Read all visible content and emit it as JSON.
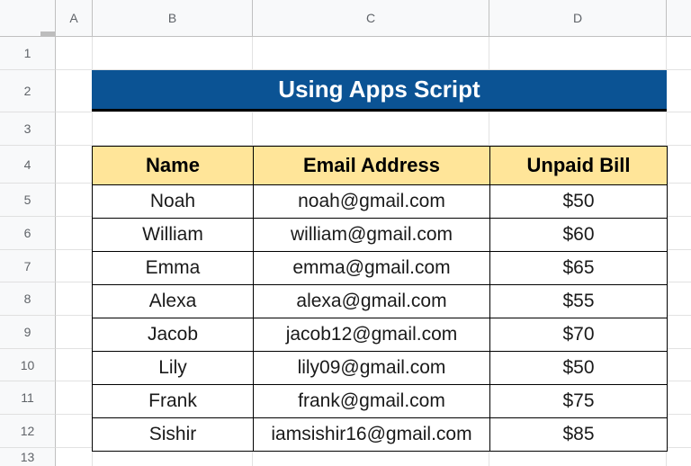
{
  "columns": [
    "A",
    "B",
    "C",
    "D"
  ],
  "rows": [
    "1",
    "2",
    "3",
    "4",
    "5",
    "6",
    "7",
    "8",
    "9",
    "10",
    "11",
    "12",
    "13"
  ],
  "title": "Using Apps Script",
  "table": {
    "headers": [
      "Name",
      "Email Address",
      "Unpaid Bill"
    ],
    "rows": [
      {
        "name": "Noah",
        "email": "noah@gmail.com",
        "bill": "$50"
      },
      {
        "name": "William",
        "email": "william@gmail.com",
        "bill": "$60"
      },
      {
        "name": "Emma",
        "email": "emma@gmail.com",
        "bill": "$65"
      },
      {
        "name": "Alexa",
        "email": "alexa@gmail.com",
        "bill": "$55"
      },
      {
        "name": "Jacob",
        "email": "jacob12@gmail.com",
        "bill": "$70"
      },
      {
        "name": "Lily",
        "email": "lily09@gmail.com",
        "bill": "$50"
      },
      {
        "name": "Frank",
        "email": "frank@gmail.com",
        "bill": "$75"
      },
      {
        "name": "Sishir",
        "email": "iamsishir16@gmail.com",
        "bill": "$85"
      }
    ]
  },
  "colors": {
    "title_bg": "#0b5394",
    "header_bg": "#ffe599"
  }
}
